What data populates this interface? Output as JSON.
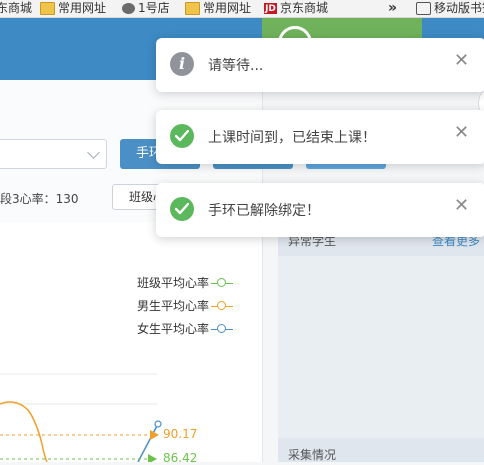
{
  "bookmarks": [
    {
      "label": "东商城",
      "icon": "folder-icon"
    },
    {
      "label": "常用网址",
      "icon": "folder-icon"
    },
    {
      "label": "1号店",
      "icon": "globe-icon"
    },
    {
      "label": "常用网址",
      "icon": "folder-icon"
    },
    {
      "label": "京东商城",
      "icon": "jd-icon"
    },
    {
      "label": "移动版书签",
      "icon": "phone-icon"
    }
  ],
  "toolbar": {
    "primary_button": "手环",
    "class_button": "班级心"
  },
  "stats": {
    "zone3_heart_rate": "段3心率：130"
  },
  "chart_data": {
    "type": "line",
    "series": [
      {
        "name": "班级平均心率",
        "color": "#6cc24a",
        "last_value": null
      },
      {
        "name": "男生平均心率",
        "color": "#f0a028",
        "last_value": "90.17"
      },
      {
        "name": "女生平均心率",
        "color": "#4a90c6",
        "last_value": "86.42"
      }
    ]
  },
  "right_panel": {
    "abnormal_title": "异常学生",
    "more_link": "查看更多",
    "collection_title": "采集情况"
  },
  "notifications": [
    {
      "type": "info",
      "icon": "info-icon",
      "message": "请等待..."
    },
    {
      "type": "success",
      "icon": "check-circle-icon",
      "message": "上课时间到，已结束上课！"
    },
    {
      "type": "success",
      "icon": "check-circle-icon",
      "message": "手环已解除绑定！"
    }
  ],
  "colors": {
    "header_blue": "#3d8ac4",
    "header_green": "#6fb25b",
    "success_green": "#5cb85c",
    "male_orange": "#f0a028",
    "class_green": "#6cc24a"
  }
}
